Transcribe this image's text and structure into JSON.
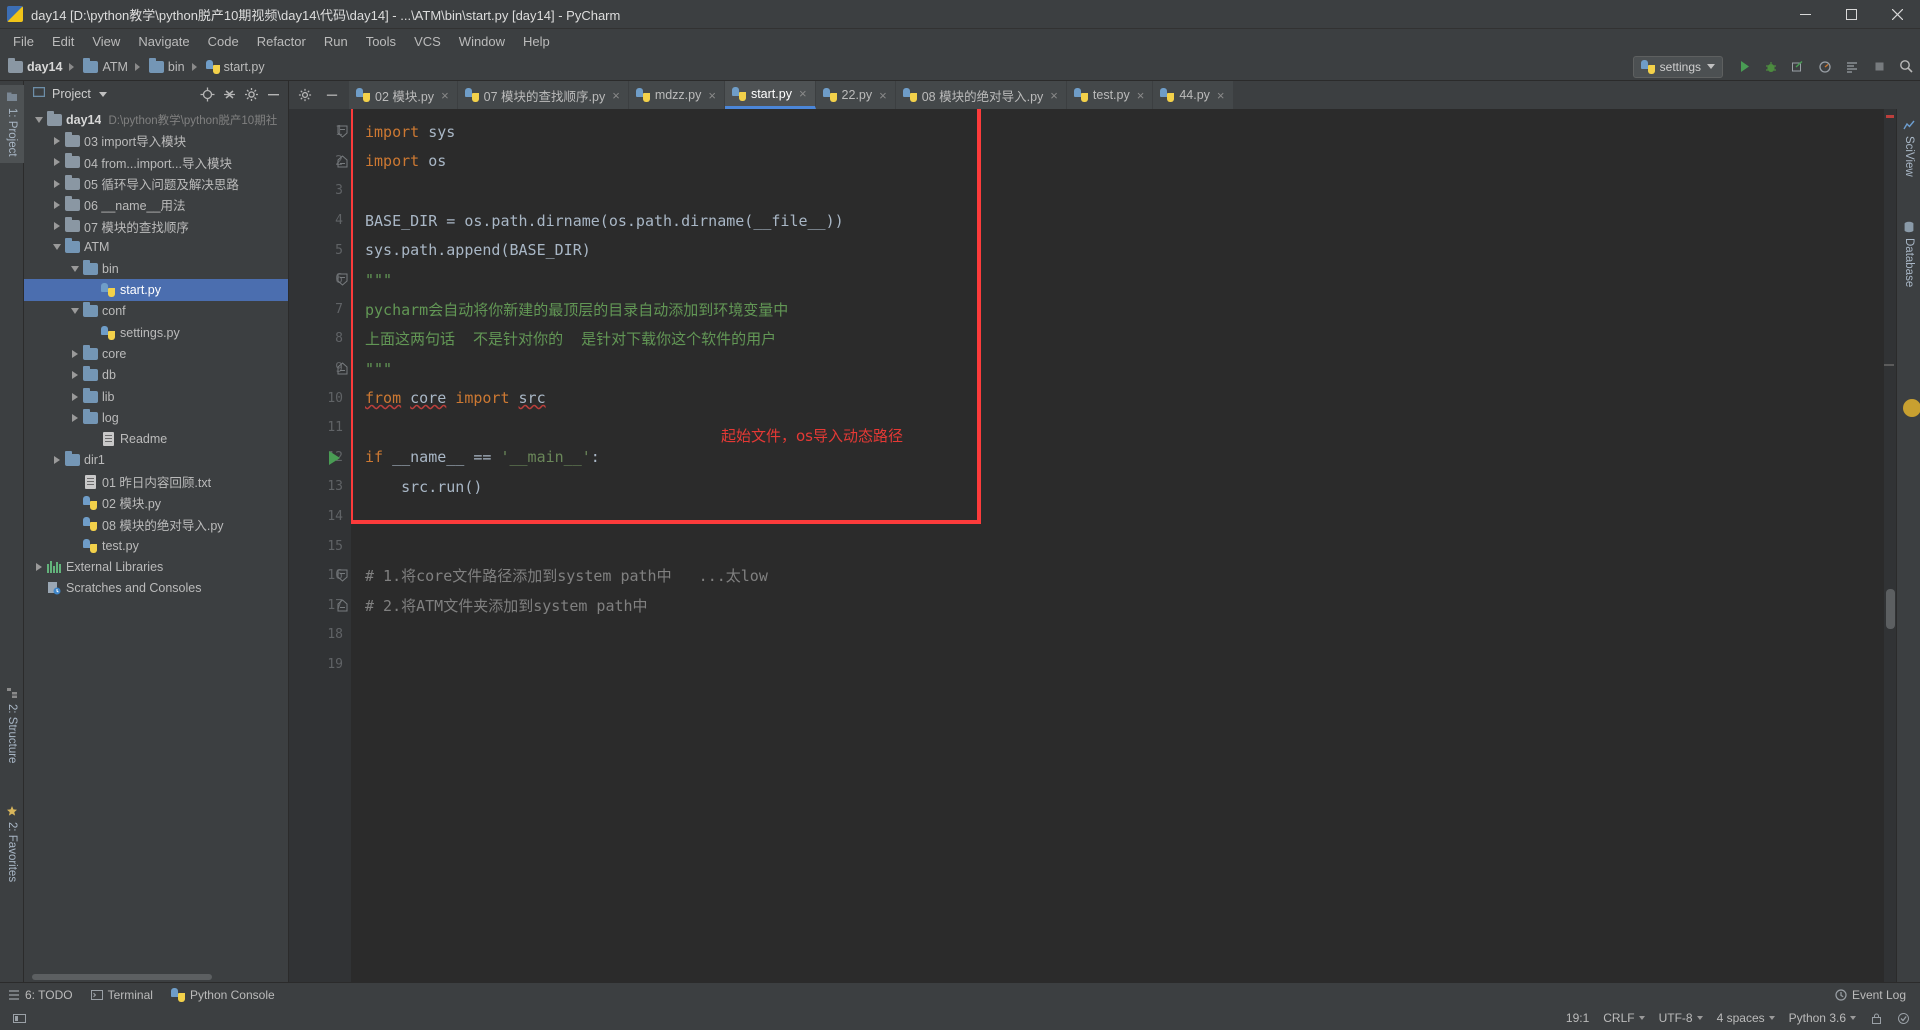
{
  "window": {
    "title": "day14 [D:\\python教学\\python脱产10期视频\\day14\\代码\\day14] - ...\\ATM\\bin\\start.py [day14] - PyCharm",
    "app_icon": "pycharm-icon",
    "minimize_label": "–",
    "maximize_label": "☐",
    "close_label": "✕"
  },
  "menu": {
    "items": [
      {
        "label": "File"
      },
      {
        "label": "Edit"
      },
      {
        "label": "View"
      },
      {
        "label": "Navigate"
      },
      {
        "label": "Code"
      },
      {
        "label": "Refactor"
      },
      {
        "label": "Run"
      },
      {
        "label": "Tools"
      },
      {
        "label": "VCS"
      },
      {
        "label": "Window"
      },
      {
        "label": "Help"
      }
    ]
  },
  "navbar": {
    "breadcrumbs": [
      {
        "label": "day14",
        "icon": "folder-icon",
        "bold": true
      },
      {
        "label": "ATM",
        "icon": "folder-icon",
        "bold": false
      },
      {
        "label": "bin",
        "icon": "folder-icon",
        "bold": false
      },
      {
        "label": "start.py",
        "icon": "python-file-icon",
        "bold": false
      }
    ],
    "run_config": {
      "label": "settings",
      "icon": "python-file-icon"
    },
    "buttons": [
      {
        "name": "run-button",
        "icon": "run-icon"
      },
      {
        "name": "debug-button",
        "icon": "debug-icon"
      },
      {
        "name": "coverage-button",
        "icon": "coverage-icon"
      },
      {
        "name": "profile-button",
        "icon": "profile-icon"
      },
      {
        "name": "attach-button",
        "icon": "attach-icon"
      },
      {
        "name": "stop-button",
        "icon": "stop-icon"
      },
      {
        "name": "search-button",
        "icon": "search-icon"
      }
    ]
  },
  "left_strip": {
    "tabs": [
      {
        "label": "1: Project",
        "selected": true,
        "icon": "project-icon"
      },
      {
        "label": "2: Structure",
        "selected": false,
        "icon": "structure-icon"
      },
      {
        "label": "2: Favorites",
        "selected": false,
        "icon": "star-icon"
      }
    ]
  },
  "right_strip": {
    "tabs": [
      {
        "label": "SciView",
        "icon": "sciview-icon"
      },
      {
        "label": "Database",
        "icon": "database-icon"
      }
    ]
  },
  "project_panel": {
    "title": "Project",
    "header_buttons": [
      {
        "name": "locate-button",
        "icon": "crosshair-icon"
      },
      {
        "name": "collapse-all-button",
        "icon": "collapse-icon"
      },
      {
        "name": "settings-button",
        "icon": "gear-icon"
      },
      {
        "name": "hide-button",
        "icon": "minus-icon"
      }
    ],
    "tree": [
      {
        "label": "day14",
        "sub": "D:\\python教学\\python脱产10期社",
        "depth": 0,
        "twisty": "down",
        "icon": "folder-icon",
        "bold": true,
        "selected": false
      },
      {
        "label": "03 import导入模块",
        "sub": "",
        "depth": 1,
        "twisty": "right",
        "icon": "folder-icon",
        "bold": false,
        "selected": false
      },
      {
        "label": "04 from...import...导入模块",
        "sub": "",
        "depth": 1,
        "twisty": "right",
        "icon": "folder-icon",
        "bold": false,
        "selected": false
      },
      {
        "label": "05 循环导入问题及解决思路",
        "sub": "",
        "depth": 1,
        "twisty": "right",
        "icon": "folder-icon",
        "bold": false,
        "selected": false
      },
      {
        "label": "06 __name__用法",
        "sub": "",
        "depth": 1,
        "twisty": "right",
        "icon": "folder-icon",
        "bold": false,
        "selected": false
      },
      {
        "label": "07 模块的查找顺序",
        "sub": "",
        "depth": 1,
        "twisty": "right",
        "icon": "folder-icon",
        "bold": false,
        "selected": false
      },
      {
        "label": "ATM",
        "sub": "",
        "depth": 1,
        "twisty": "down",
        "icon": "folder-blue-icon",
        "bold": false,
        "selected": false
      },
      {
        "label": "bin",
        "sub": "",
        "depth": 2,
        "twisty": "down",
        "icon": "folder-blue-icon",
        "bold": false,
        "selected": false
      },
      {
        "label": "start.py",
        "sub": "",
        "depth": 3,
        "twisty": "none",
        "icon": "python-file-icon",
        "bold": false,
        "selected": true
      },
      {
        "label": "conf",
        "sub": "",
        "depth": 2,
        "twisty": "down",
        "icon": "folder-blue-icon",
        "bold": false,
        "selected": false
      },
      {
        "label": "settings.py",
        "sub": "",
        "depth": 3,
        "twisty": "none",
        "icon": "python-file-icon",
        "bold": false,
        "selected": false
      },
      {
        "label": "core",
        "sub": "",
        "depth": 2,
        "twisty": "right",
        "icon": "folder-blue-icon",
        "bold": false,
        "selected": false
      },
      {
        "label": "db",
        "sub": "",
        "depth": 2,
        "twisty": "right",
        "icon": "folder-blue-icon",
        "bold": false,
        "selected": false
      },
      {
        "label": "lib",
        "sub": "",
        "depth": 2,
        "twisty": "right",
        "icon": "folder-blue-icon",
        "bold": false,
        "selected": false
      },
      {
        "label": "log",
        "sub": "",
        "depth": 2,
        "twisty": "right",
        "icon": "folder-blue-icon",
        "bold": false,
        "selected": false
      },
      {
        "label": "Readme",
        "sub": "",
        "depth": 3,
        "twisty": "none",
        "icon": "text-file-icon",
        "bold": false,
        "selected": false
      },
      {
        "label": "dir1",
        "sub": "",
        "depth": 1,
        "twisty": "right",
        "icon": "folder-blue-icon",
        "bold": false,
        "selected": false
      },
      {
        "label": "01 昨日内容回顾.txt",
        "sub": "",
        "depth": 2,
        "twisty": "none",
        "icon": "text-file-icon",
        "bold": false,
        "selected": false
      },
      {
        "label": "02 模块.py",
        "sub": "",
        "depth": 2,
        "twisty": "none",
        "icon": "python-file-icon",
        "bold": false,
        "selected": false
      },
      {
        "label": "08 模块的绝对导入.py",
        "sub": "",
        "depth": 2,
        "twisty": "none",
        "icon": "python-file-icon",
        "bold": false,
        "selected": false
      },
      {
        "label": "test.py",
        "sub": "",
        "depth": 2,
        "twisty": "none",
        "icon": "python-file-icon",
        "bold": false,
        "selected": false
      },
      {
        "label": "External Libraries",
        "sub": "",
        "depth": 0,
        "twisty": "right",
        "icon": "library-icon",
        "bold": false,
        "selected": false
      },
      {
        "label": "Scratches and Consoles",
        "sub": "",
        "depth": 0,
        "twisty": "none",
        "icon": "scratches-icon",
        "bold": false,
        "selected": false
      }
    ]
  },
  "editor": {
    "tabs": [
      {
        "label": "02 模块.py",
        "active": false
      },
      {
        "label": "07 模块的查找顺序.py",
        "active": false
      },
      {
        "label": "mdzz.py",
        "active": false
      },
      {
        "label": "start.py",
        "active": true
      },
      {
        "label": "22.py",
        "active": false
      },
      {
        "label": "08 模块的绝对导入.py",
        "active": false
      },
      {
        "label": "test.py",
        "active": false
      },
      {
        "label": "44.py",
        "active": false
      }
    ],
    "tab_close_label": "×",
    "line_numbers": [
      "1",
      "2",
      "3",
      "4",
      "5",
      "6",
      "7",
      "8",
      "9",
      "10",
      "11",
      "12",
      "13",
      "14",
      "15",
      "16",
      "17",
      "18",
      "19"
    ],
    "lines": [
      {
        "n": 1,
        "tokens": [
          {
            "t": "import",
            "c": "kw"
          },
          {
            "t": " sys",
            "c": "plain"
          }
        ]
      },
      {
        "n": 2,
        "tokens": [
          {
            "t": "import",
            "c": "kw"
          },
          {
            "t": " os",
            "c": "plain"
          }
        ]
      },
      {
        "n": 3,
        "tokens": []
      },
      {
        "n": 4,
        "tokens": [
          {
            "t": "BASE_DIR = os.path.dirname(os.path.dirname(__file__))",
            "c": "plain"
          }
        ]
      },
      {
        "n": 5,
        "tokens": [
          {
            "t": "sys.path.append(BASE_DIR)",
            "c": "plain"
          }
        ]
      },
      {
        "n": 6,
        "tokens": [
          {
            "t": "\"\"\"",
            "c": "doc"
          }
        ]
      },
      {
        "n": 7,
        "tokens": [
          {
            "t": "pycharm会自动将你新建的最顶层的目录自动添加到环境变量中",
            "c": "doc"
          }
        ]
      },
      {
        "n": 8,
        "tokens": [
          {
            "t": "上面这两句话  不是针对你的  是针对下载你这个软件的用户",
            "c": "doc"
          }
        ]
      },
      {
        "n": 9,
        "tokens": [
          {
            "t": "\"\"\"",
            "c": "doc"
          }
        ]
      },
      {
        "n": 10,
        "tokens": [
          {
            "t": "from",
            "c": "kw-err"
          },
          {
            "t": " ",
            "c": "plain"
          },
          {
            "t": "core",
            "c": "plain-err"
          },
          {
            "t": " ",
            "c": "plain"
          },
          {
            "t": "import",
            "c": "kw"
          },
          {
            "t": " ",
            "c": "plain"
          },
          {
            "t": "src",
            "c": "plain-err"
          }
        ]
      },
      {
        "n": 11,
        "tokens": []
      },
      {
        "n": 12,
        "tokens": [
          {
            "t": "if",
            "c": "kw"
          },
          {
            "t": " __name__ == ",
            "c": "plain"
          },
          {
            "t": "'__main__'",
            "c": "str"
          },
          {
            "t": ":",
            "c": "plain"
          }
        ]
      },
      {
        "n": 13,
        "tokens": [
          {
            "t": "    src.run()",
            "c": "plain"
          }
        ]
      },
      {
        "n": 14,
        "tokens": []
      },
      {
        "n": 15,
        "tokens": []
      },
      {
        "n": 16,
        "tokens": [
          {
            "t": "# 1.将core文件路径添加到system path中   ...太low",
            "c": "comment"
          }
        ]
      },
      {
        "n": 17,
        "tokens": [
          {
            "t": "# 2.将ATM文件夹添加到system path中",
            "c": "comment"
          }
        ]
      },
      {
        "n": 18,
        "tokens": []
      },
      {
        "n": 19,
        "tokens": []
      }
    ],
    "annotation": "起始文件，os导入动态路径",
    "annotation_color": "#e53935",
    "highlight_box_color": "#fc3b3b",
    "run_marker_line": 12
  },
  "tool_window_bar": {
    "items": [
      {
        "label": "6: TODO",
        "icon": "todo-icon"
      },
      {
        "label": "Terminal",
        "icon": "terminal-icon"
      },
      {
        "label": "Python Console",
        "icon": "python-console-icon"
      }
    ],
    "event_log": {
      "label": "Event Log",
      "icon": "event-log-icon"
    }
  },
  "status_bar": {
    "caret_position": "19:1",
    "line_separator": "CRLF",
    "encoding": "UTF-8",
    "indent": "4 spaces",
    "interpreter": "Python 3.6",
    "lock_icon": "lock-icon",
    "inspection_icon": "inspection-icon"
  }
}
